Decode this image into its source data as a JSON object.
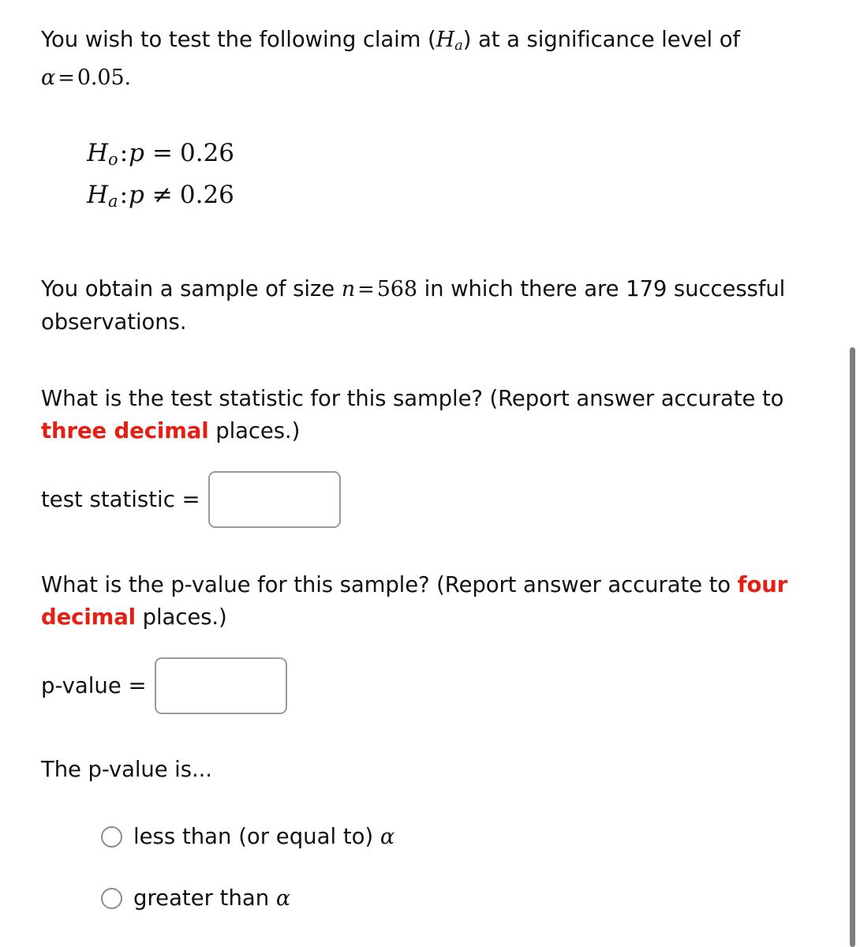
{
  "problem": {
    "intro": {
      "part1": "You wish to test the following claim (",
      "ha_symbol": "H",
      "ha_sub": "a",
      "part2": ") at a significance level of ",
      "alpha_symbol": "α",
      "equals": "=",
      "alpha_value": "0.05",
      "period": "."
    },
    "hypotheses": [
      {
        "label": "H",
        "subscript": "o",
        "colon": ":",
        "parameter": "p",
        "relation": "=",
        "value": "0.26"
      },
      {
        "label": "H",
        "subscript": "a",
        "colon": ":",
        "parameter": "p",
        "relation": "≠",
        "value": "0.26"
      }
    ],
    "sample": {
      "part1": "You obtain a sample of size ",
      "n_symbol": "n",
      "equals": "=",
      "n_value": "568",
      "part2": " in which there are ",
      "successes": "179",
      "part3": " successful observations."
    }
  },
  "questions": [
    {
      "id": "test-statistic",
      "prompt_part1": "What is the test statistic for this sample? (Report answer accurate to ",
      "emphasis": "three decimal",
      "prompt_part2": " places.)",
      "answer_label": "test statistic =",
      "answer_value": "",
      "answer_placeholder": ""
    },
    {
      "id": "p-value",
      "prompt_part1": "What is the p-value for this sample? (Report answer accurate to ",
      "emphasis": "four decimal",
      "prompt_part2": " places.)",
      "answer_label": "p-value =",
      "answer_value": "",
      "answer_placeholder": ""
    }
  ],
  "conclusion": {
    "prompt": "The p-value is...",
    "options": [
      {
        "id": "less-than-alpha",
        "text_before": "less than (or equal to) ",
        "alpha": "α",
        "selected": false
      },
      {
        "id": "greater-than-alpha",
        "text_before": "greater than ",
        "alpha": "α",
        "selected": false
      }
    ]
  },
  "colors": {
    "emphasis_red": "#e51f13",
    "text_black": "#111111",
    "input_border": "#9a9a9a",
    "radio_border": "#8c8c8c",
    "scrollbar_thumb": "#7d7d7d",
    "background": "#ffffff"
  }
}
